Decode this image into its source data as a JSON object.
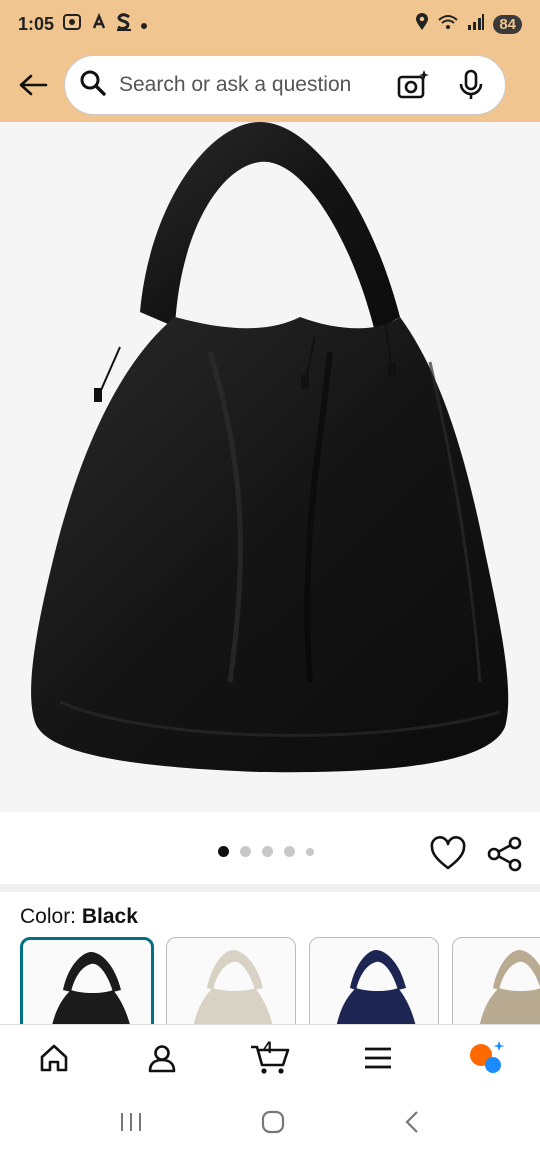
{
  "status": {
    "time": "1:05",
    "signal_label": "6",
    "battery": "84"
  },
  "header": {
    "search_placeholder": "Search or ask a question"
  },
  "product": {
    "image_alt": "Black nylon hobo shoulder bag",
    "carousel": {
      "total": 5,
      "active_index": 0
    }
  },
  "colors": {
    "prefix": "Color: ",
    "selected": "Black",
    "options": [
      {
        "name": "Black",
        "hex": "#1b1b1b"
      },
      {
        "name": "Beige",
        "hex": "#d8d2c4"
      },
      {
        "name": "Navy",
        "hex": "#1d2552"
      },
      {
        "name": "Khaki",
        "hex": "#b8ab92"
      }
    ]
  },
  "bottom_nav": {
    "cart_count": "4",
    "items": [
      "home-icon",
      "account-icon",
      "cart-icon",
      "menu-icon",
      "rufus-icon"
    ]
  },
  "theme": {
    "header_bg": "#f1c590",
    "accent_teal": "#007185"
  }
}
